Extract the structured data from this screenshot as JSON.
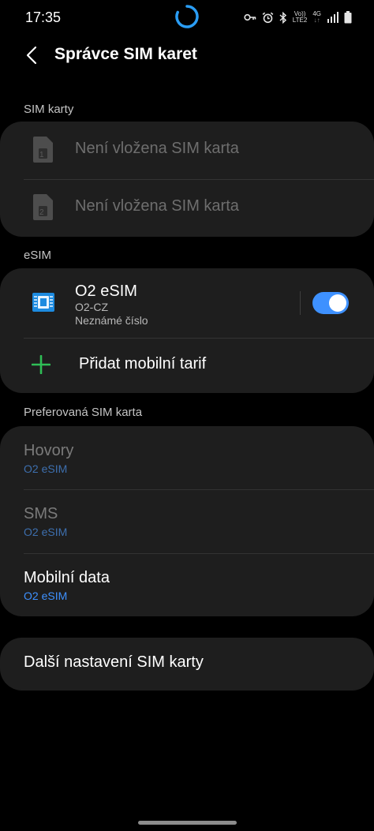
{
  "status_bar": {
    "time": "17:35",
    "net_top": "Vo))",
    "net_bottom": "LTE2",
    "gen": "4G",
    "gen_arrows": "↓↑",
    "icons": [
      "loading-spinner",
      "key-icon",
      "alarm-icon",
      "bluetooth-icon",
      "signal-icon",
      "battery-icon"
    ]
  },
  "app_bar": {
    "title": "Správce SIM karet",
    "back_icon": "chevron-left-icon"
  },
  "sim_cards": {
    "header": "SIM karty",
    "slots": [
      {
        "slot": "1",
        "label": "Není vložena SIM karta"
      },
      {
        "slot": "2",
        "label": "Není vložena SIM karta"
      }
    ]
  },
  "esim": {
    "header": "eSIM",
    "name": "O2 eSIM",
    "operator": "O2-CZ",
    "number": "Neznámé číslo",
    "enabled": true,
    "add_label": "Přidat mobilní tarif"
  },
  "preferred": {
    "header": "Preferovaná SIM karta",
    "items": [
      {
        "title": "Hovory",
        "value": "O2 eSIM",
        "active": false
      },
      {
        "title": "SMS",
        "value": "O2 eSIM",
        "active": false
      },
      {
        "title": "Mobilní data",
        "value": "O2 eSIM",
        "active": true
      }
    ]
  },
  "more_settings": {
    "label": "Další nastavení SIM karty"
  },
  "colors": {
    "background": "#000000",
    "card": "#1e1e1e",
    "accent": "#3e91ff",
    "add_icon": "#2fbe56"
  }
}
